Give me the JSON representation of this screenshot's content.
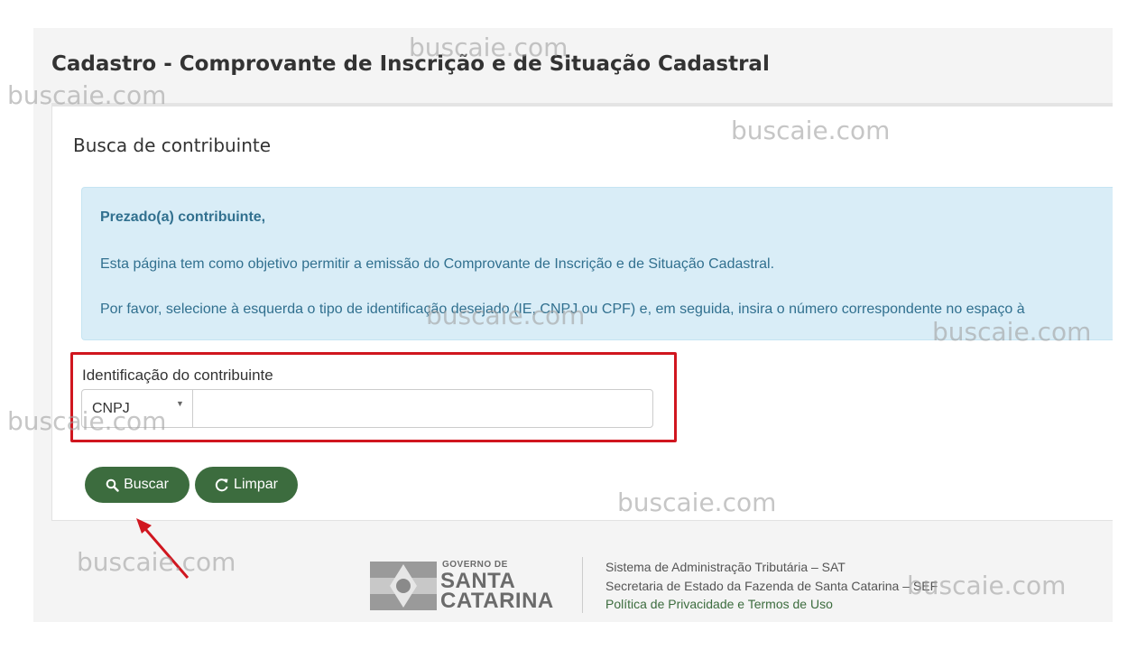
{
  "page": {
    "title": "Cadastro - Comprovante de Inscrição e de Situação Cadastral"
  },
  "panel": {
    "heading": "Busca de contribuinte"
  },
  "alert": {
    "title": "Prezado(a) contribuinte,",
    "line1": "Esta página tem como objetivo permitir a emissão do Comprovante de Inscrição e de Situação Cadastral.",
    "line2": "Por favor, selecione à esquerda o tipo de identificação desejado (IE, CNPJ ou CPF) e, em seguida, insira o número correspondente no espaço à"
  },
  "form": {
    "label": "Identificação do contribuinte",
    "id_type_selected": "CNPJ",
    "id_value": ""
  },
  "buttons": {
    "search": "Buscar",
    "clear": "Limpar"
  },
  "footer": {
    "logo_small": "GOVERNO DE",
    "logo_line1": "SANTA",
    "logo_line2": "CATARINA",
    "line1": "Sistema de Administração Tributária – SAT",
    "line2": "Secretaria de Estado da Fazenda de Santa Catarina – SEF",
    "link": "Política de Privacidade e Termos de Uso"
  },
  "watermark": "buscaie.com",
  "colors": {
    "primary_green": "#3c6c3e",
    "alert_bg": "#d9edf7",
    "alert_text": "#31708f",
    "highlight_red": "#d0161f"
  }
}
